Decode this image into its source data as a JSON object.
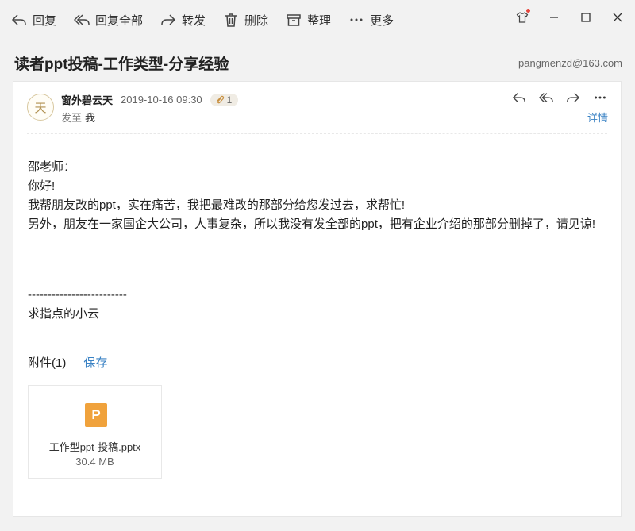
{
  "toolbar": {
    "reply": "回复",
    "reply_all": "回复全部",
    "forward": "转发",
    "delete": "删除",
    "organize": "整理",
    "more": "更多"
  },
  "mail": {
    "subject": "读者ppt投稿-工作类型-分享经验",
    "account": "pangmenzd@163.com",
    "avatar_char": "天",
    "sender": "窗外碧云天",
    "time": "2019-10-16 09:30",
    "attachment_count_badge": "1",
    "to_label": "发至",
    "to_name": "我",
    "details": "详情",
    "body_lines": [
      "邵老师：",
      "你好!",
      "我帮朋友改的ppt，实在痛苦，我把最难改的那部分给您发过去，求帮忙!",
      "另外，朋友在一家国企大公司，人事复杂，所以我没有发全部的ppt，把有企业介绍的那部分删掉了，请见谅!"
    ],
    "signature_rule": "-------------------------",
    "signature_name": "求指点的小云"
  },
  "attachments": {
    "header": "附件(1)",
    "save": "保存",
    "file": {
      "icon_letter": "P",
      "name": "工作型ppt-投稿.pptx",
      "size": "30.4 MB"
    }
  }
}
